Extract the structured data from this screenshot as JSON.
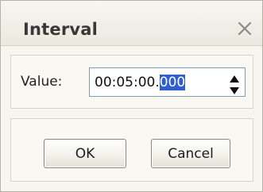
{
  "dialog": {
    "title": "Interval",
    "close_icon": "close-icon"
  },
  "field": {
    "label": "Value:",
    "value_prefix": "00:05:00.",
    "value_selected": "000",
    "full_value": "00:05:00.000",
    "spin_up_icon": "spin-up-arrow-icon",
    "spin_down_icon": "spin-down-arrow-icon"
  },
  "buttons": {
    "ok_label": "OK",
    "cancel_label": "Cancel"
  },
  "colors": {
    "selection": "#2f5fcf",
    "field_border": "#7f9db9",
    "dialog_background": "#f6f5ef"
  }
}
